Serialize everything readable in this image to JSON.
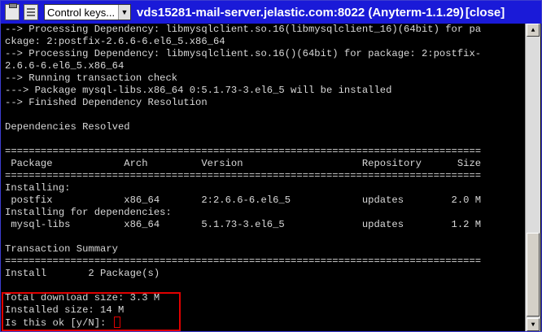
{
  "titlebar": {
    "select_value": "Control keys...",
    "title": "vds15281-mail-server.jelastic.com:8022 (Anyterm-1.1.29)",
    "close_label": "[close]"
  },
  "terminal": {
    "lines": [
      "--> Processing Dependency: libmysqlclient.so.16(libmysqlclient_16)(64bit) for pa",
      "ckage: 2:postfix-2.6.6-6.el6_5.x86_64",
      "--> Processing Dependency: libmysqlclient.so.16()(64bit) for package: 2:postfix-",
      "2.6.6-6.el6_5.x86_64",
      "--> Running transaction check",
      "---> Package mysql-libs.x86_64 0:5.1.73-3.el6_5 will be installed",
      "--> Finished Dependency Resolution",
      "",
      "Dependencies Resolved",
      "",
      "================================================================================",
      " Package            Arch         Version                    Repository      Size",
      "================================================================================",
      "Installing:",
      " postfix            x86_64       2:2.6.6-6.el6_5            updates        2.0 M",
      "Installing for dependencies:",
      " mysql-libs         x86_64       5.1.73-3.el6_5             updates        1.2 M",
      "",
      "Transaction Summary",
      "================================================================================",
      "Install       2 Package(s)",
      "",
      "Total download size: 3.3 M",
      "Installed size: 14 M",
      "Is this ok [y/N]: "
    ]
  }
}
